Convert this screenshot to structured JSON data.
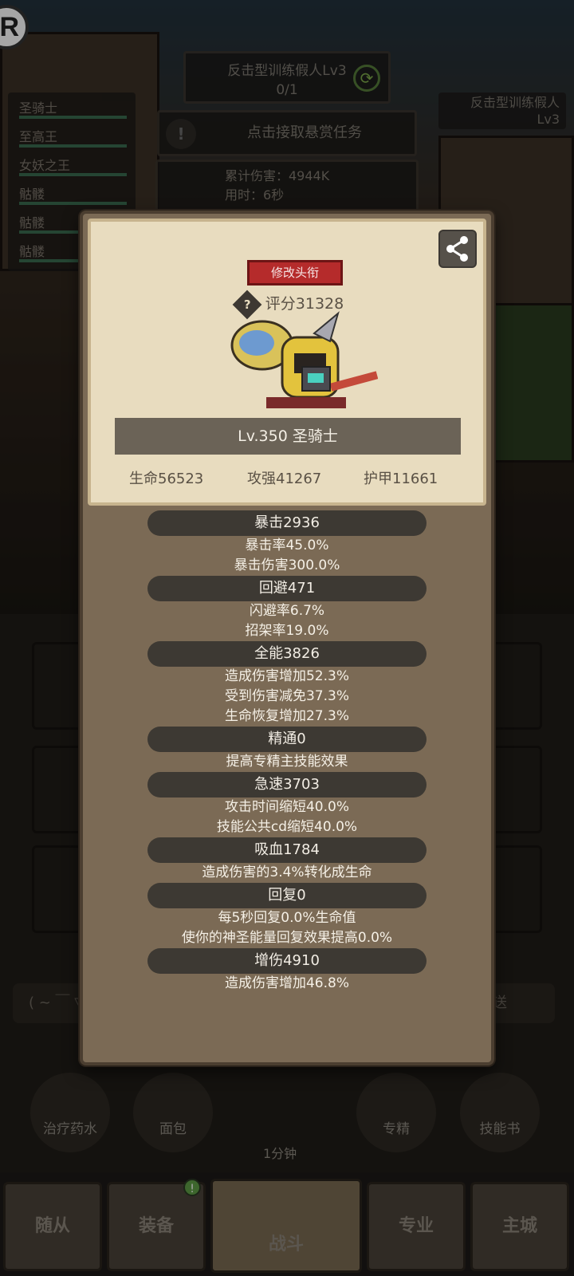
{
  "header": {
    "quest_title": "反击型训练假人Lv3",
    "quest_progress": "0/1",
    "bounty_label": "点击接取悬赏任务",
    "damage_line": "累计伤害：4944K",
    "time_line": "用时：6秒",
    "enemy_name": "反击型训练假人",
    "enemy_level": "Lv3"
  },
  "party": [
    {
      "name": "圣骑士"
    },
    {
      "name": "至高王"
    },
    {
      "name": "女妖之王"
    },
    {
      "name": "骷髅"
    },
    {
      "name": "骷髅"
    },
    {
      "name": "骷髅"
    }
  ],
  "chat": {
    "placeholder": "( ~ ￣ ▽",
    "send_label": "发送"
  },
  "items": [
    {
      "label": "治疗药水"
    },
    {
      "label": "面包"
    },
    {
      "label": "专精"
    },
    {
      "label": "技能书"
    }
  ],
  "chest_timer": "1分钟",
  "nav": {
    "tabs": [
      {
        "label": "随从"
      },
      {
        "label": "装备"
      },
      {
        "label": "战斗"
      },
      {
        "label": "专业"
      },
      {
        "label": "主城"
      }
    ],
    "equip_badge": "!"
  },
  "card": {
    "title_button": "修改头衔",
    "score": "评分31328",
    "level_name": "Lv.350 圣骑士",
    "hp": "生命56523",
    "attack": "攻强41267",
    "armor": "护甲11661",
    "stats": [
      {
        "head": "暴击2936",
        "lines": [
          "暴击率45.0%",
          "暴击伤害300.0%"
        ]
      },
      {
        "head": "回避471",
        "lines": [
          "闪避率6.7%",
          "招架率19.0%"
        ]
      },
      {
        "head": "全能3826",
        "lines": [
          "造成伤害增加52.3%",
          "受到伤害减免37.3%",
          "生命恢复增加27.3%"
        ]
      },
      {
        "head": "精通0",
        "lines": [
          "提高专精主技能效果"
        ]
      },
      {
        "head": "急速3703",
        "lines": [
          "攻击时间缩短40.0%",
          "技能公共cd缩短40.0%"
        ]
      },
      {
        "head": "吸血1784",
        "lines": [
          "造成伤害的3.4%转化成生命"
        ]
      },
      {
        "head": "回复0",
        "lines": [
          "每5秒回复0.0%生命值",
          "使你的神圣能量回复效果提高0.0%"
        ]
      },
      {
        "head": "增伤4910",
        "lines": [
          "造成伤害增加46.8%"
        ]
      }
    ]
  }
}
